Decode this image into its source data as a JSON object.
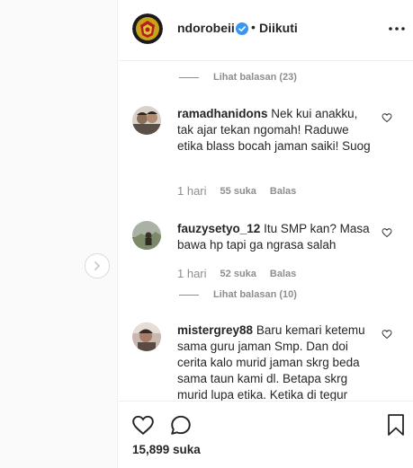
{
  "post": {
    "author": "ndorobeii",
    "separator": "•",
    "follow_status": "Diikuti"
  },
  "comments": {
    "replies_top": "Lihat balasan (23)",
    "items": [
      {
        "username": "ramadhanidons",
        "text": "Nek kui anakku, tak ajar tekan ngomah! Raduwe etika blass bocah jaman saiki! Suog",
        "age": "1 hari",
        "likes": "55 suka",
        "reply_label": "Balas"
      },
      {
        "username": "fauzysetyo_12",
        "text": "Itu SMP kan? Masa bawa hp tapi ga ngrasa salah",
        "age": "1 hari",
        "likes": "52 suka",
        "reply_label": "Balas",
        "replies": "Lihat balasan (10)"
      },
      {
        "username": "mistergrey88",
        "text": "Baru kemari ketemu sama guru jaman Smp. Dan doi cerita kalo murid jaman skrg beda sama taun kami dl. Betapa skrg murid lupa etika. Ketika di tegur"
      }
    ]
  },
  "footer": {
    "likes_count": "15,899 suka"
  },
  "icons": {
    "verified": "verified-badge-icon",
    "more": "more-options-icon",
    "heart": "heart-icon",
    "comment": "comment-bubble-icon",
    "save": "bookmark-icon",
    "next": "chevron-right-icon"
  },
  "colors": {
    "text": "#262626",
    "muted": "#8e8e8e",
    "verified": "#3897f0",
    "border": "#efefef"
  }
}
